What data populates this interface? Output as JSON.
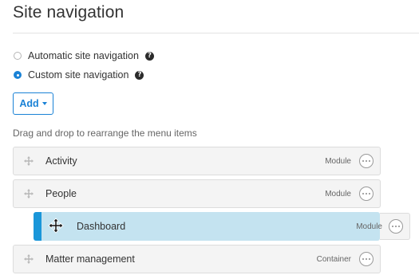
{
  "page": {
    "title": "Site navigation"
  },
  "options": [
    {
      "label": "Automatic site navigation",
      "checked": false
    },
    {
      "label": "Custom site navigation",
      "checked": true
    }
  ],
  "add_button": {
    "label": "Add"
  },
  "hint": "Drag and drop to rearrange the menu items",
  "menu_items": [
    {
      "label": "Activity",
      "type": "Module"
    },
    {
      "label": "People",
      "type": "Module"
    },
    {
      "label": "Dashboard",
      "type": "Module",
      "state": "dragging"
    },
    {
      "label": "Matter management",
      "type": "Container"
    }
  ],
  "colors": {
    "accent": "#1a82d6",
    "drag_highlight": "#c4e3f0",
    "drag_bar": "#1a96d9",
    "item_background": "#f4f4f4"
  },
  "icons": {
    "drag_handle": "drag-handle-icon",
    "help": "help-icon",
    "more": "more-options-icon",
    "move_cursor": "move-cursor-icon"
  }
}
